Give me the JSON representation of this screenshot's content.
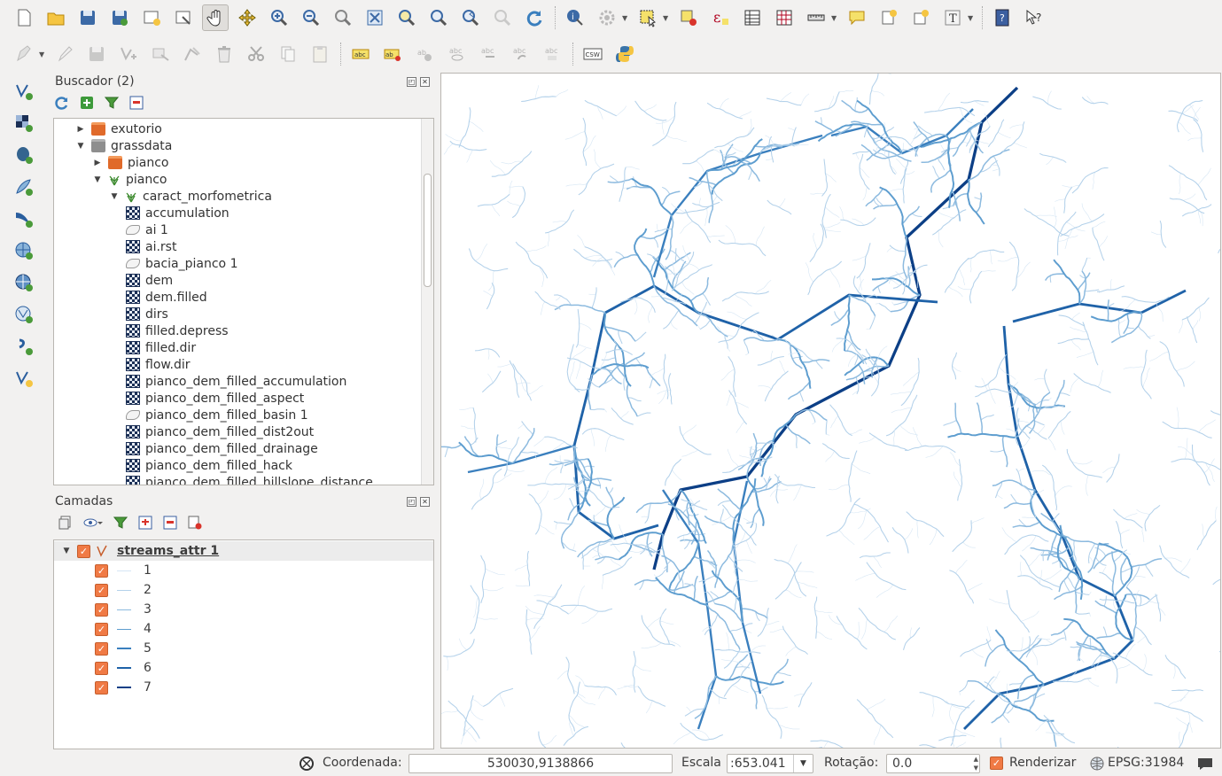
{
  "browser": {
    "title": "Buscador (2)",
    "tree": [
      {
        "label": "exutorio",
        "icon": "folder-icon",
        "indent": 0,
        "arrow": "right"
      },
      {
        "label": "grassdata",
        "icon": "folder-grey-icon",
        "indent": 0,
        "arrow": "down"
      },
      {
        "label": "pianco",
        "icon": "folder-icon",
        "indent": 1,
        "arrow": "right"
      },
      {
        "label": "pianco",
        "icon": "grass-location-icon",
        "indent": 1,
        "arrow": "down"
      },
      {
        "label": "caract_morfometrica",
        "icon": "grass-mapset-icon",
        "indent": 2,
        "arrow": "down"
      },
      {
        "label": "accumulation",
        "icon": "raster-icon",
        "indent": 3
      },
      {
        "label": "ai 1",
        "icon": "vector-icon",
        "indent": 3
      },
      {
        "label": "ai.rst",
        "icon": "raster-icon",
        "indent": 3
      },
      {
        "label": "bacia_pianco 1",
        "icon": "vector-icon",
        "indent": 3
      },
      {
        "label": "dem",
        "icon": "raster-icon",
        "indent": 3
      },
      {
        "label": "dem.filled",
        "icon": "raster-icon",
        "indent": 3
      },
      {
        "label": "dirs",
        "icon": "raster-icon",
        "indent": 3
      },
      {
        "label": "filled.depress",
        "icon": "raster-icon",
        "indent": 3
      },
      {
        "label": "filled.dir",
        "icon": "raster-icon",
        "indent": 3
      },
      {
        "label": "flow.dir",
        "icon": "raster-icon",
        "indent": 3
      },
      {
        "label": "pianco_dem_filled_accumulation",
        "icon": "raster-icon",
        "indent": 3
      },
      {
        "label": "pianco_dem_filled_aspect",
        "icon": "raster-icon",
        "indent": 3
      },
      {
        "label": "pianco_dem_filled_basin 1",
        "icon": "vector-icon",
        "indent": 3
      },
      {
        "label": "pianco_dem_filled_dist2out",
        "icon": "raster-icon",
        "indent": 3
      },
      {
        "label": "pianco_dem_filled_drainage",
        "icon": "raster-icon",
        "indent": 3
      },
      {
        "label": "pianco_dem_filled_hack",
        "icon": "raster-icon",
        "indent": 3
      },
      {
        "label": "pianco_dem_filled_hillslope_distance",
        "icon": "raster-icon",
        "indent": 3
      }
    ]
  },
  "layers": {
    "title": "Camadas",
    "layer_name": "streams_attr 1",
    "classes": [
      {
        "label": "1",
        "color": "#d6e6f4"
      },
      {
        "label": "2",
        "color": "#b3d1ea"
      },
      {
        "label": "3",
        "color": "#8cbadf"
      },
      {
        "label": "4",
        "color": "#5d9dcf"
      },
      {
        "label": "5",
        "color": "#3a7fbe"
      },
      {
        "label": "6",
        "color": "#1f62a8"
      },
      {
        "label": "7",
        "color": "#0c3f86"
      }
    ]
  },
  "status": {
    "coord_label": "Coordenada:",
    "coord_value": "530030,9138866",
    "scale_label": "Escala",
    "scale_value": ":653.041",
    "rotation_label": "Rotação:",
    "rotation_value": "0.0",
    "render_label": "Renderizar",
    "crs": "EPSG:31984"
  },
  "toolbar2": {
    "csw_label": "CSW"
  }
}
